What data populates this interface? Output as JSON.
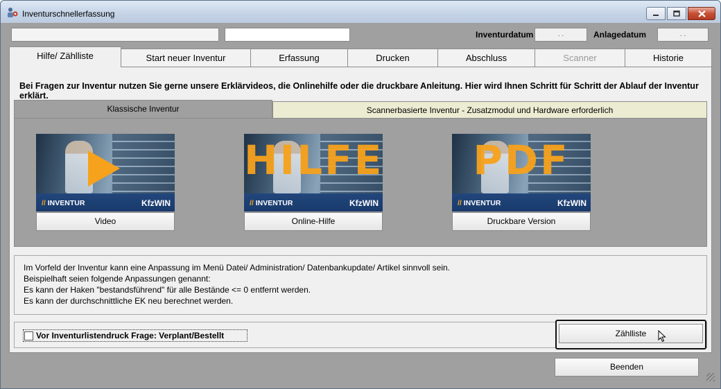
{
  "window": {
    "title": "Inventurschnellerfassung",
    "icon": "app-user-gear-icon",
    "controls": [
      "minimize-icon",
      "maximize-icon",
      "close-icon"
    ]
  },
  "header": {
    "field1_value": "",
    "field2_value": "",
    "inventurdatum_label": "Inventurdatum",
    "inventurdatum_value": ". .",
    "anlagedatum_label": "Anlagedatum",
    "anlagedatum_value": ". ."
  },
  "tabs": [
    {
      "label": "Hilfe/ Zählliste",
      "state": "active"
    },
    {
      "label": "Start neuer Inventur",
      "state": "normal"
    },
    {
      "label": "Erfassung",
      "state": "normal"
    },
    {
      "label": "Drucken",
      "state": "normal"
    },
    {
      "label": "Abschluss",
      "state": "normal"
    },
    {
      "label": "Scanner",
      "state": "disabled"
    },
    {
      "label": "Historie",
      "state": "normal"
    }
  ],
  "intro_text": "Bei Fragen zur Inventur nutzen Sie gerne unsere Erklärvideos, die Onlinehilfe oder die druckbare Anleitung. Hier wird Ihnen Schritt für Schritt der Ablauf der Inventur erklärt.",
  "subtabs": [
    {
      "label": "Klassische Inventur",
      "state": "active"
    },
    {
      "label": "Scannerbasierte Inventur - Zusatzmodul und Hardware erforderlich",
      "state": "inactive"
    }
  ],
  "tiles": [
    {
      "overlay": "",
      "band_left": "INVENTUR",
      "band_right": "KfzWIN",
      "button": "Video"
    },
    {
      "overlay": "HILFE",
      "band_left": "INVENTUR",
      "band_right": "KfzWIN",
      "button": "Online-Hilfe"
    },
    {
      "overlay": "PDF",
      "band_left": "INVENTUR",
      "band_right": "KfzWIN",
      "button": "Druckbare Version"
    }
  ],
  "band_slash": "//",
  "info_lines": [
    "Im Vorfeld der Inventur kann eine Anpassung im Menü Datei/ Administration/ Datenbankupdate/ Artikel sinnvoll sein.",
    "Beispielhaft seien folgende Anpassungen genannt:",
    "Es kann der Haken \"bestandsführend\" für alle Bestände <= 0 entfernt werden.",
    "Es kann der durchschnittliche EK neu berechnet werden."
  ],
  "checkbox": {
    "label": "Vor Inventurlistendruck Frage: Verplant/Bestellt",
    "checked": false
  },
  "buttons": {
    "zaehlliste": "Zählliste",
    "beenden": "Beenden"
  },
  "colors": {
    "accent_orange": "#f7a21c",
    "band_blue": "#1e4174",
    "panel_gray": "#a0a0a0"
  }
}
